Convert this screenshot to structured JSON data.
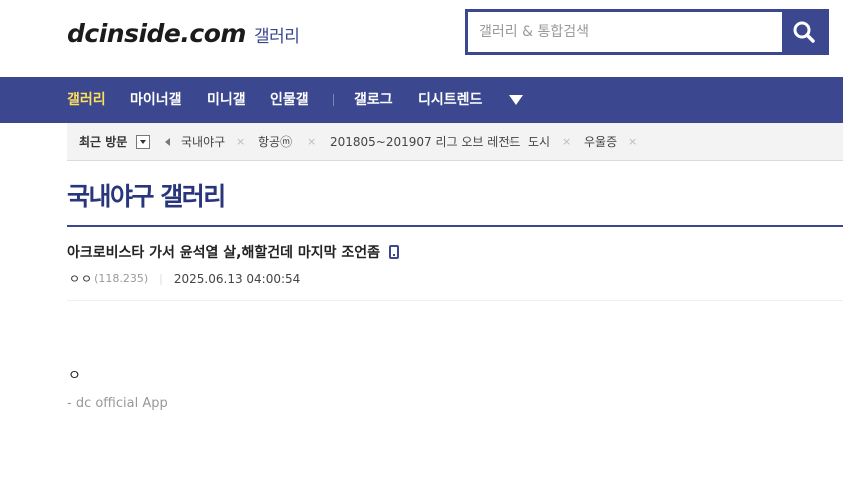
{
  "header": {
    "logo_text": "dcinside.com",
    "logo_sub": "갤러리",
    "search_placeholder": "갤러리 & 통합검색",
    "search_icon": "search-icon"
  },
  "nav": {
    "items": [
      {
        "label": "갤러리",
        "active": true
      },
      {
        "label": "마이너갤",
        "active": false
      },
      {
        "label": "미니갤",
        "active": false
      },
      {
        "label": "인물갤",
        "active": false
      },
      {
        "label": "갤로그",
        "active": false
      },
      {
        "label": "디시트렌드",
        "active": false
      }
    ],
    "more_icon": "caret-down-icon"
  },
  "recent": {
    "label": "최근 방문",
    "items": [
      "국내야구",
      "항공ⓜ",
      "201805~201907 리그 오브 레전드",
      "도시",
      "우울증"
    ],
    "close_glyph": "×"
  },
  "gallery": {
    "title": "국내야구 갤러리"
  },
  "post": {
    "title": "아크로비스타 가서 윤석열 살,해할건데 마지막 조언좀",
    "nickname": "ㅇㅇ",
    "ip": "(118.235)",
    "separator": "|",
    "date": "2025.06.13 04:00:54",
    "body": "ㅇ",
    "signature": "- dc official App",
    "device_icon": "mobile-icon"
  },
  "colors": {
    "brand": "#3b4890",
    "active_nav": "#ffde5a",
    "title": "#29367c"
  }
}
